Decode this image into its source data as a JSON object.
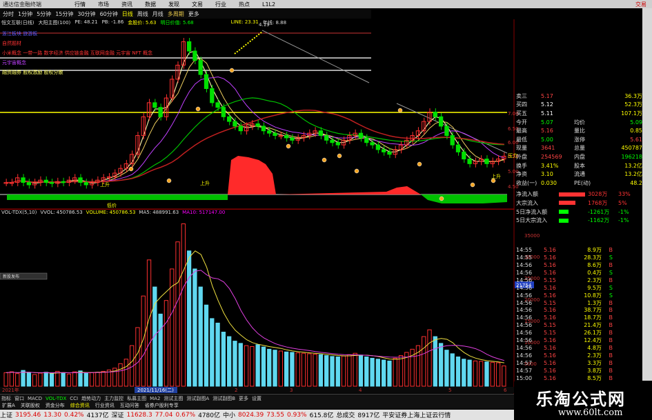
{
  "menu": {
    "app": "通达信金融终端",
    "items": [
      "行情",
      "市场",
      "资讯",
      "数据",
      "发现",
      "文易",
      "行业",
      "热点",
      "L1L2"
    ],
    "right": "交易"
  },
  "periods": {
    "items": [
      "分时",
      "1分钟",
      "5分钟",
      "15分钟",
      "30分钟",
      "60分钟"
    ],
    "daily": "日线",
    "weekly": "周线",
    "monthly": "月线",
    "multi": "多周期",
    "more": "更多"
  },
  "kline_header": {
    "name": "恒文互联(日线)",
    "main": "大阳主图(100)",
    "pe": "PE: 48.21",
    "pb": "PB: -1.86",
    "kd": "金股价: 5.63",
    "fund": "明日价值: 5.68",
    "line": "LINE: 23.31",
    "year": "年线: 8.88"
  },
  "notes": [
    {
      "text": "浙江板块 旅游板",
      "color": "#5c5cff"
    },
    {
      "text": "自然题材",
      "color": "#ff3333"
    },
    {
      "text": "小米概念 一带一路 数字经济 供应链金融 互联网金融 元宇宙 NFT 概念",
      "color": "#ff3333"
    },
    {
      "text": "元宇宙概念",
      "color": "#c040ff"
    },
    {
      "text": "融资融券 股权激励 股权分散",
      "color": "#ffff66"
    }
  ],
  "chart_labels": {
    "peak": "4.19",
    "left_up": "上升",
    "mid_up": "上升",
    "right_up": "上升",
    "right_label": "压力",
    "low": "低价"
  },
  "price_axis": [
    "7.00",
    "6.50",
    "6.00",
    "5.50",
    "5.00",
    "4.50"
  ],
  "vol_header": {
    "name": "VOL-TDX(5,10)",
    "vvol": "VVOL: 450786.53",
    "volume": "VOLUME: 450786.53",
    "ma5": "MA5: 488991.63",
    "ma10": "MA10: 517147.00"
  },
  "vol_axis": [
    "35000",
    "30000",
    "25000",
    "20000",
    "15000",
    "10000",
    "5000"
  ],
  "vol_marker": "21754",
  "date_label": "2021/11/16(二)",
  "x_marks": [
    "2021年",
    "2",
    "3",
    "4",
    "5",
    "6"
  ],
  "side_tag": "新股发布",
  "quote": [
    {
      "l": "卖三",
      "v": "5.17",
      "r": "36.3万",
      "vc": "#ff4444"
    },
    {
      "l": "买四",
      "v": "5.12",
      "r": "52.3万",
      "vc": "#ffffff"
    },
    {
      "l": "买五",
      "v": "5.11",
      "r": "107.1万",
      "vc": "#ffffff"
    },
    {
      "l": "今开",
      "v": "5.07",
      "r2l": "均价",
      "r": "5.09",
      "vc": "#00ff00"
    },
    {
      "l": "最高",
      "v": "5.16",
      "r2l": "量比",
      "r": "0.85",
      "vc": "#ff4444"
    },
    {
      "l": "最低",
      "v": "5.00",
      "r2l": "涨停",
      "r": "5.61",
      "vc": "#00ff00"
    },
    {
      "l": "现量",
      "v": "3641",
      "r2l": "总量",
      "r": "450787",
      "vc": "#ff4444"
    },
    {
      "l": "外盘",
      "v": "254569",
      "r2l": "内盘",
      "r": "196218",
      "vc": "#ff4444"
    },
    {
      "l": "换手",
      "v": "3.41%",
      "r2l": "股本",
      "r": "13.2亿",
      "vc": "#ffff00"
    },
    {
      "l": "净资",
      "v": "3.10",
      "r2l": "流通",
      "r": "13.2亿",
      "vc": "#ffff00"
    },
    {
      "l": "收益(一)",
      "v": "0.030",
      "r2l": "PE(动)",
      "r": "48.2",
      "vc": "#ffff00"
    }
  ],
  "flow": [
    {
      "l": "净流入额",
      "v": "3028万",
      "pct": "33%",
      "c": "#ff3333"
    },
    {
      "l": "大宗流入",
      "v": "1768万",
      "pct": "5%",
      "c": "#ff3333"
    },
    {
      "l": "5日净流入额",
      "v": "-1261万",
      "pct": "-1%",
      "c": "#00ff00"
    },
    {
      "l": "5日大宗流入",
      "v": "-1162万",
      "pct": "-1%",
      "c": "#00ff00"
    }
  ],
  "ticks": [
    {
      "t": "14:55",
      "p": "5.16",
      "v": "8.9万",
      "s": "B"
    },
    {
      "t": "14:55",
      "p": "5.16",
      "v": "28.3万",
      "s": "S"
    },
    {
      "t": "14:56",
      "p": "5.16",
      "v": "8.6万",
      "s": "B"
    },
    {
      "t": "14:56",
      "p": "5.16",
      "v": "0.4万",
      "s": "S"
    },
    {
      "t": "14:56",
      "p": "5.15",
      "v": "2.3万",
      "s": "B"
    },
    {
      "t": "14:56",
      "p": "5.16",
      "v": "9.5万",
      "s": "S"
    },
    {
      "t": "14:56",
      "p": "5.16",
      "v": "10.8万",
      "s": "S"
    },
    {
      "t": "14:56",
      "p": "5.15",
      "v": "1.3万",
      "s": "B"
    },
    {
      "t": "14:56",
      "p": "5.16",
      "v": "38.7万",
      "s": "B"
    },
    {
      "t": "14:56",
      "p": "5.16",
      "v": "18.7万",
      "s": "B"
    },
    {
      "t": "14:56",
      "p": "5.15",
      "v": "21.4万",
      "s": "B"
    },
    {
      "t": "14:56",
      "p": "5.15",
      "v": "26.1万",
      "s": "B"
    },
    {
      "t": "14:56",
      "p": "5.16",
      "v": "12.4万",
      "s": "B"
    },
    {
      "t": "14:56",
      "p": "5.16",
      "v": "4.8万",
      "s": "B"
    },
    {
      "t": "14:56",
      "p": "5.16",
      "v": "2.3万",
      "s": "B"
    },
    {
      "t": "14:57",
      "p": "5.16",
      "v": "3.3万",
      "s": "B"
    },
    {
      "t": "14:57",
      "p": "5.16",
      "v": "3.8万",
      "s": "B"
    },
    {
      "t": "15:00",
      "p": "5.16",
      "v": "8.5万",
      "s": "B"
    }
  ],
  "tabs": [
    "指标",
    "窗口",
    "MACD",
    "VOL-TDX",
    "CCI",
    "趋势动力",
    "主力监控",
    "私募主图",
    "MA2",
    "测试主图",
    "测试副图A",
    "测试副图B",
    "更多",
    "设置"
  ],
  "status": [
    "扩展A",
    "关联股权",
    "资金分布",
    "综合资讯",
    "行业资讯",
    "互动问答",
    "省券户股利专享"
  ],
  "ticker": {
    "sh_n": "上证",
    "sh_v": "3195.46",
    "sh_c": "13.30",
    "sh_p": "0.42%",
    "sh_a": "4137亿",
    "sz_n": "深证",
    "sz_v": "11628.3",
    "sz_c": "77.04",
    "sz_p": "0.67%",
    "sz_a": "4780亿",
    "zx_n": "中小",
    "zx_v": "8024.39",
    "zx_c": "73.55",
    "zx_p": "0.93%",
    "zx_a": "615.8亿",
    "tot_n": "总成交",
    "tot_v": "8917亿",
    "broker": "平安证券上海上证云行情"
  },
  "brand": {
    "title": "乐淘公式网",
    "url": "www.60lt.com"
  },
  "chart_data": {
    "type": "candlestick",
    "ylim": [
      4.5,
      7.0
    ],
    "close": [
      4.6,
      4.6,
      4.7,
      4.6,
      4.55,
      4.6,
      4.65,
      4.6,
      4.58,
      4.62,
      4.6,
      4.65,
      4.7,
      4.6,
      4.55,
      4.6,
      4.65,
      4.7,
      4.72,
      4.8,
      4.9,
      5.0,
      5.2,
      5.6,
      6.0,
      6.3,
      6.2,
      6.0,
      6.4,
      6.8,
      7.1,
      7.6,
      7.4,
      7.2,
      6.9,
      6.6,
      6.3,
      6.2,
      6.0,
      5.9,
      5.8,
      5.7,
      5.8,
      5.85,
      5.8,
      5.7,
      5.65,
      5.6,
      5.6,
      5.55,
      5.5,
      5.55,
      5.6,
      5.65,
      5.7,
      5.6,
      5.5,
      5.45,
      5.4,
      5.5,
      5.6,
      5.65,
      5.55,
      5.45,
      5.4,
      5.3,
      5.25,
      5.2,
      5.3,
      5.4,
      5.5,
      5.6,
      5.7,
      5.9,
      6.1,
      6.0,
      5.8,
      5.6,
      5.4,
      5.25,
      5.1,
      5.0,
      5.05,
      5.1,
      5.0,
      5.05,
      5.1,
      5.16
    ],
    "volume": [
      3000,
      3200,
      2800,
      3500,
      3000,
      2600,
      2900,
      3100,
      2800,
      3300,
      3000,
      2700,
      3200,
      3400,
      2900,
      3000,
      3100,
      3300,
      3600,
      4000,
      5000,
      6000,
      9000,
      13000,
      20000,
      28000,
      22000,
      16000,
      19000,
      26000,
      32000,
      36000,
      30000,
      26000,
      22000,
      18000,
      15000,
      14000,
      12000,
      11000,
      10000,
      9500,
      9000,
      8800,
      9200,
      8700,
      8200,
      8000,
      7800,
      7600,
      7500,
      7400,
      7300,
      7200,
      7100,
      7000,
      6800,
      6600,
      6500,
      6700,
      7000,
      7300,
      6900,
      6500,
      6200,
      6000,
      5800,
      5600,
      6200,
      6800,
      7500,
      8200,
      9000,
      11000,
      12500,
      11000,
      9500,
      8000,
      7200,
      6500,
      6000,
      5800,
      5600,
      5500,
      5400,
      5300,
      5200,
      4500
    ]
  }
}
